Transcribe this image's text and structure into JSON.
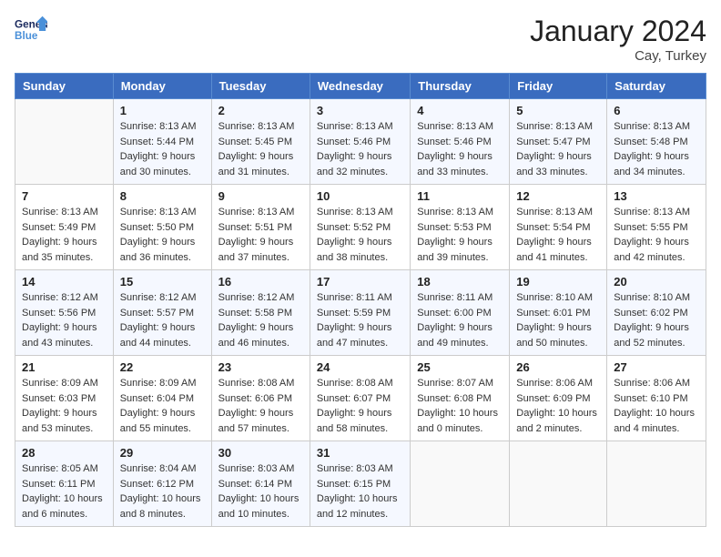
{
  "header": {
    "logo_line1": "General",
    "logo_line2": "Blue",
    "month": "January 2024",
    "location": "Cay, Turkey"
  },
  "days_of_week": [
    "Sunday",
    "Monday",
    "Tuesday",
    "Wednesday",
    "Thursday",
    "Friday",
    "Saturday"
  ],
  "weeks": [
    [
      {
        "day": "",
        "sunrise": "",
        "sunset": "",
        "daylight": ""
      },
      {
        "day": "1",
        "sunrise": "Sunrise: 8:13 AM",
        "sunset": "Sunset: 5:44 PM",
        "daylight": "Daylight: 9 hours and 30 minutes."
      },
      {
        "day": "2",
        "sunrise": "Sunrise: 8:13 AM",
        "sunset": "Sunset: 5:45 PM",
        "daylight": "Daylight: 9 hours and 31 minutes."
      },
      {
        "day": "3",
        "sunrise": "Sunrise: 8:13 AM",
        "sunset": "Sunset: 5:46 PM",
        "daylight": "Daylight: 9 hours and 32 minutes."
      },
      {
        "day": "4",
        "sunrise": "Sunrise: 8:13 AM",
        "sunset": "Sunset: 5:46 PM",
        "daylight": "Daylight: 9 hours and 33 minutes."
      },
      {
        "day": "5",
        "sunrise": "Sunrise: 8:13 AM",
        "sunset": "Sunset: 5:47 PM",
        "daylight": "Daylight: 9 hours and 33 minutes."
      },
      {
        "day": "6",
        "sunrise": "Sunrise: 8:13 AM",
        "sunset": "Sunset: 5:48 PM",
        "daylight": "Daylight: 9 hours and 34 minutes."
      }
    ],
    [
      {
        "day": "7",
        "sunrise": "Sunrise: 8:13 AM",
        "sunset": "Sunset: 5:49 PM",
        "daylight": "Daylight: 9 hours and 35 minutes."
      },
      {
        "day": "8",
        "sunrise": "Sunrise: 8:13 AM",
        "sunset": "Sunset: 5:50 PM",
        "daylight": "Daylight: 9 hours and 36 minutes."
      },
      {
        "day": "9",
        "sunrise": "Sunrise: 8:13 AM",
        "sunset": "Sunset: 5:51 PM",
        "daylight": "Daylight: 9 hours and 37 minutes."
      },
      {
        "day": "10",
        "sunrise": "Sunrise: 8:13 AM",
        "sunset": "Sunset: 5:52 PM",
        "daylight": "Daylight: 9 hours and 38 minutes."
      },
      {
        "day": "11",
        "sunrise": "Sunrise: 8:13 AM",
        "sunset": "Sunset: 5:53 PM",
        "daylight": "Daylight: 9 hours and 39 minutes."
      },
      {
        "day": "12",
        "sunrise": "Sunrise: 8:13 AM",
        "sunset": "Sunset: 5:54 PM",
        "daylight": "Daylight: 9 hours and 41 minutes."
      },
      {
        "day": "13",
        "sunrise": "Sunrise: 8:13 AM",
        "sunset": "Sunset: 5:55 PM",
        "daylight": "Daylight: 9 hours and 42 minutes."
      }
    ],
    [
      {
        "day": "14",
        "sunrise": "Sunrise: 8:12 AM",
        "sunset": "Sunset: 5:56 PM",
        "daylight": "Daylight: 9 hours and 43 minutes."
      },
      {
        "day": "15",
        "sunrise": "Sunrise: 8:12 AM",
        "sunset": "Sunset: 5:57 PM",
        "daylight": "Daylight: 9 hours and 44 minutes."
      },
      {
        "day": "16",
        "sunrise": "Sunrise: 8:12 AM",
        "sunset": "Sunset: 5:58 PM",
        "daylight": "Daylight: 9 hours and 46 minutes."
      },
      {
        "day": "17",
        "sunrise": "Sunrise: 8:11 AM",
        "sunset": "Sunset: 5:59 PM",
        "daylight": "Daylight: 9 hours and 47 minutes."
      },
      {
        "day": "18",
        "sunrise": "Sunrise: 8:11 AM",
        "sunset": "Sunset: 6:00 PM",
        "daylight": "Daylight: 9 hours and 49 minutes."
      },
      {
        "day": "19",
        "sunrise": "Sunrise: 8:10 AM",
        "sunset": "Sunset: 6:01 PM",
        "daylight": "Daylight: 9 hours and 50 minutes."
      },
      {
        "day": "20",
        "sunrise": "Sunrise: 8:10 AM",
        "sunset": "Sunset: 6:02 PM",
        "daylight": "Daylight: 9 hours and 52 minutes."
      }
    ],
    [
      {
        "day": "21",
        "sunrise": "Sunrise: 8:09 AM",
        "sunset": "Sunset: 6:03 PM",
        "daylight": "Daylight: 9 hours and 53 minutes."
      },
      {
        "day": "22",
        "sunrise": "Sunrise: 8:09 AM",
        "sunset": "Sunset: 6:04 PM",
        "daylight": "Daylight: 9 hours and 55 minutes."
      },
      {
        "day": "23",
        "sunrise": "Sunrise: 8:08 AM",
        "sunset": "Sunset: 6:06 PM",
        "daylight": "Daylight: 9 hours and 57 minutes."
      },
      {
        "day": "24",
        "sunrise": "Sunrise: 8:08 AM",
        "sunset": "Sunset: 6:07 PM",
        "daylight": "Daylight: 9 hours and 58 minutes."
      },
      {
        "day": "25",
        "sunrise": "Sunrise: 8:07 AM",
        "sunset": "Sunset: 6:08 PM",
        "daylight": "Daylight: 10 hours and 0 minutes."
      },
      {
        "day": "26",
        "sunrise": "Sunrise: 8:06 AM",
        "sunset": "Sunset: 6:09 PM",
        "daylight": "Daylight: 10 hours and 2 minutes."
      },
      {
        "day": "27",
        "sunrise": "Sunrise: 8:06 AM",
        "sunset": "Sunset: 6:10 PM",
        "daylight": "Daylight: 10 hours and 4 minutes."
      }
    ],
    [
      {
        "day": "28",
        "sunrise": "Sunrise: 8:05 AM",
        "sunset": "Sunset: 6:11 PM",
        "daylight": "Daylight: 10 hours and 6 minutes."
      },
      {
        "day": "29",
        "sunrise": "Sunrise: 8:04 AM",
        "sunset": "Sunset: 6:12 PM",
        "daylight": "Daylight: 10 hours and 8 minutes."
      },
      {
        "day": "30",
        "sunrise": "Sunrise: 8:03 AM",
        "sunset": "Sunset: 6:14 PM",
        "daylight": "Daylight: 10 hours and 10 minutes."
      },
      {
        "day": "31",
        "sunrise": "Sunrise: 8:03 AM",
        "sunset": "Sunset: 6:15 PM",
        "daylight": "Daylight: 10 hours and 12 minutes."
      },
      {
        "day": "",
        "sunrise": "",
        "sunset": "",
        "daylight": ""
      },
      {
        "day": "",
        "sunrise": "",
        "sunset": "",
        "daylight": ""
      },
      {
        "day": "",
        "sunrise": "",
        "sunset": "",
        "daylight": ""
      }
    ]
  ]
}
